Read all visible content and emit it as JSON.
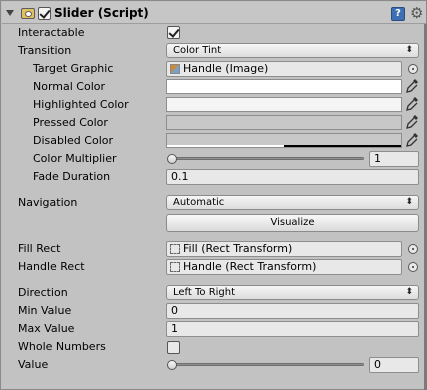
{
  "header": {
    "title": "Slider (Script)",
    "help_icon": "help-book-icon",
    "settings_icon": "gear-icon",
    "help_glyph": "?",
    "gear_glyph": "⚙"
  },
  "labels": {
    "interactable": "Interactable",
    "transition": "Transition",
    "target_graphic": "Target Graphic",
    "normal_color": "Normal Color",
    "highlighted_color": "Highlighted Color",
    "pressed_color": "Pressed Color",
    "disabled_color": "Disabled Color",
    "color_multiplier": "Color Multiplier",
    "fade_duration": "Fade Duration",
    "navigation": "Navigation",
    "fill_rect": "Fill Rect",
    "handle_rect": "Handle Rect",
    "direction": "Direction",
    "min_value": "Min Value",
    "max_value": "Max Value",
    "whole_numbers": "Whole Numbers",
    "value": "Value"
  },
  "values": {
    "interactable": true,
    "transition": "Color Tint",
    "target_graphic": "Handle (Image)",
    "normal_color": "#ffffff",
    "highlighted_color": "#f5f5f5",
    "pressed_color": "#c8c8c8",
    "disabled_color": "#c8c8c8",
    "disabled_color_alpha": 0.5,
    "color_multiplier": "1",
    "color_multiplier_fraction": 0,
    "fade_duration": "0.1",
    "navigation": "Automatic",
    "visualize_label": "Visualize",
    "fill_rect": "Fill (Rect Transform)",
    "handle_rect": "Handle (Rect Transform)",
    "direction": "Left To Right",
    "min_value": "0",
    "max_value": "1",
    "whole_numbers": false,
    "value": "0",
    "value_fraction": 0
  },
  "icons": {
    "dropdown_arrow": "⬍"
  },
  "colors": {
    "panel": "#c2c2c2",
    "help_icon": "#3d6fb4"
  }
}
